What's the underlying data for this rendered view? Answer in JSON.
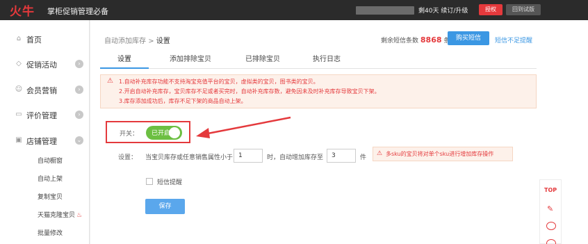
{
  "topbar": {
    "logo": "火牛",
    "app_name": "掌柜促销管理必备",
    "days_left": "剩40天 续订/升级",
    "auth_button": "授权",
    "old_version_button": "回到试版"
  },
  "sidebar": {
    "items": [
      {
        "label": "首页",
        "icon": "home-icon"
      },
      {
        "label": "促销活动",
        "icon": "tag-icon"
      },
      {
        "label": "会员营销",
        "icon": "user-icon"
      },
      {
        "label": "评价管理",
        "icon": "comment-icon"
      },
      {
        "label": "店铺管理",
        "icon": "shop-icon"
      }
    ],
    "sub_items": [
      "自动橱窗",
      "自动上架",
      "复制宝贝",
      "天猫克隆宝贝",
      "批量修改"
    ]
  },
  "breadcrumb": {
    "parent": "自动添加库存",
    "separator": ">",
    "current": "设置"
  },
  "sms": {
    "prefix": "剩余短信条数",
    "count": "8868",
    "unit": "条",
    "buy_button": "购买短信",
    "remind_link": "短信不足提醒"
  },
  "tabs": [
    "设置",
    "添加排除宝贝",
    "已排除宝贝",
    "执行日志"
  ],
  "notice": {
    "lines": [
      "1.自动补充库存功能不支持淘宝充值平台的宝贝，虚拟类的宝贝，图书类的宝贝。",
      "2.开启自动补充库存，宝贝库存不足或者买完时，自动补充库存数，避免因未及时补充库存导致宝贝下架。",
      "3.库存添加成功后，库存不足下架的商品自动上架。"
    ]
  },
  "switch": {
    "label": "开关：",
    "state_text": "已开启",
    "on": true
  },
  "setting": {
    "label": "设置：",
    "text1": "当宝贝库存或任意销售属性小于",
    "threshold": "1",
    "text2": "时，自动增加库存至",
    "restock_to": "3",
    "text3": "件",
    "warning": "多sku的宝贝将对单个sku进行增加库存操作"
  },
  "sms_remind": {
    "label": "短信提醒",
    "checked": false
  },
  "save_button": "保存",
  "floatbar": {
    "top_label": "TOP"
  },
  "colors": {
    "accent": "#3b97e3",
    "brand_red": "#e4393c",
    "switch_on": "#6cbf42",
    "topbar_bg": "#2b2b2b"
  }
}
